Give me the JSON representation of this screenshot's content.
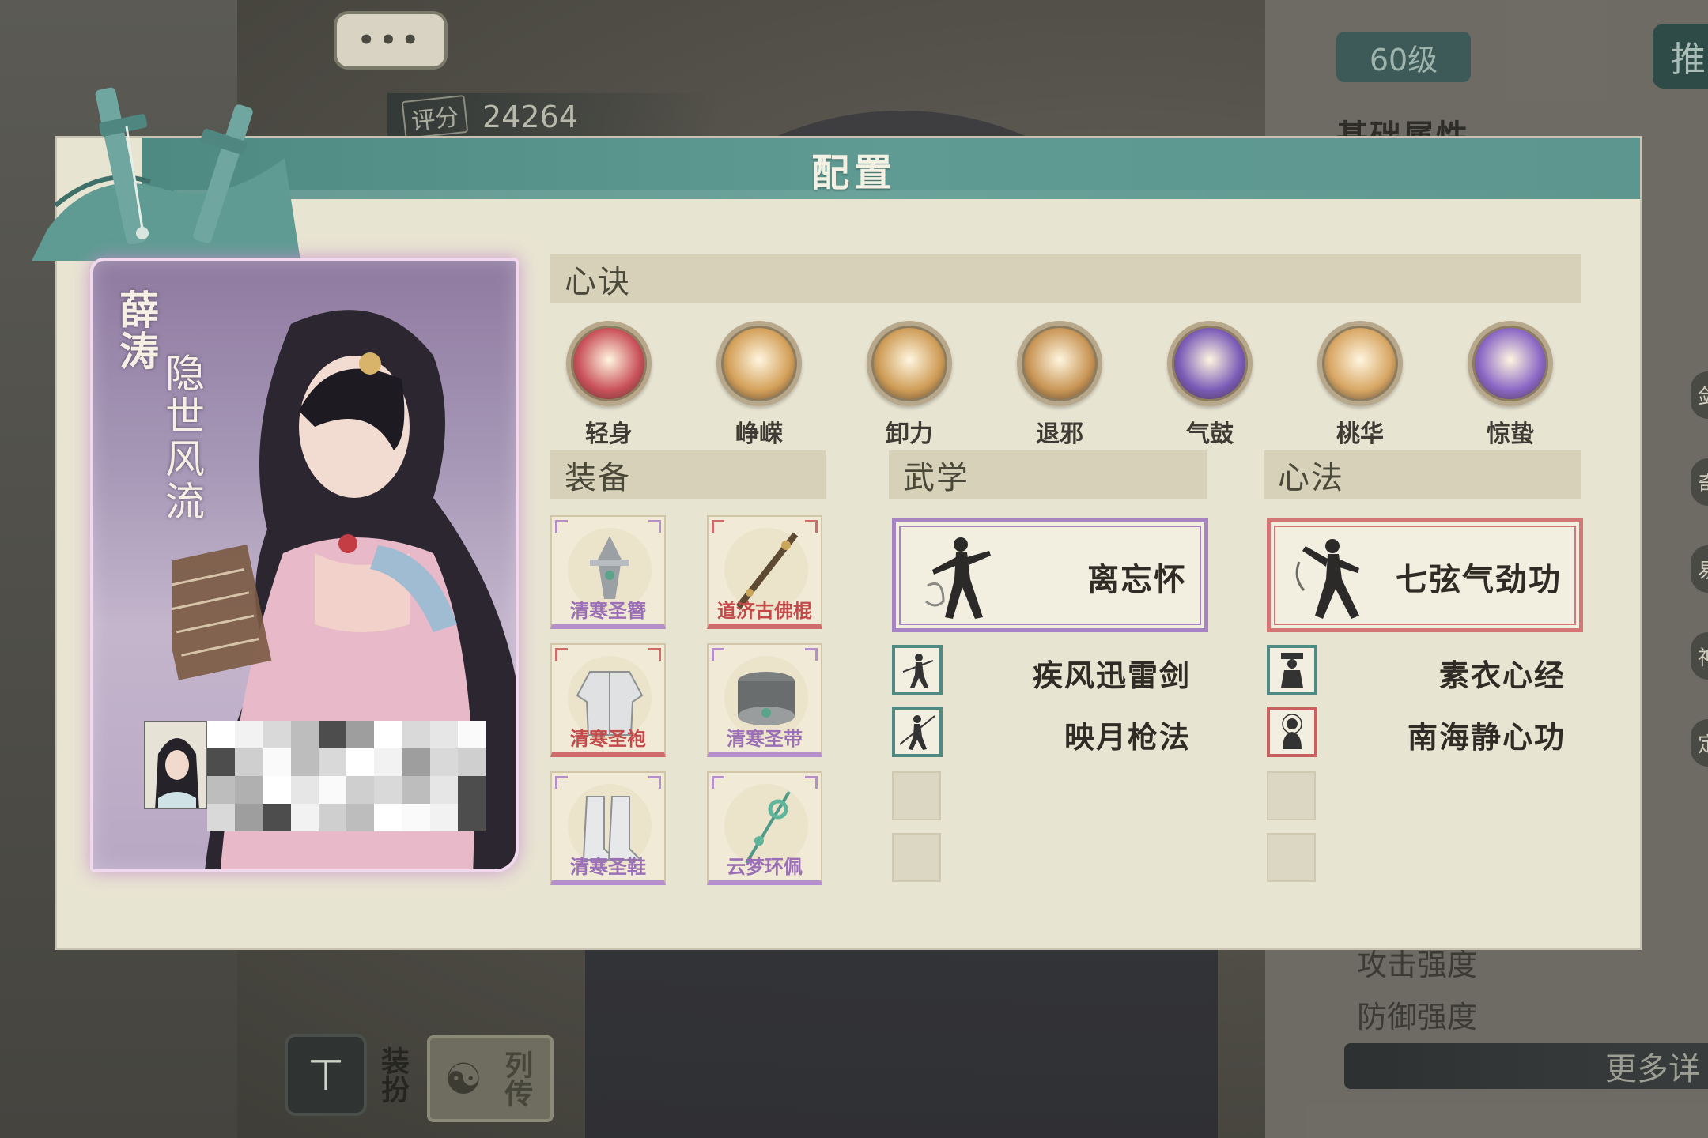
{
  "background": {
    "score_label": "评分",
    "score_value": "24264",
    "level": "60级",
    "top_right_button": "推",
    "basic_attr_title": "基础属性",
    "stats": [
      "攻击强度",
      "防御强度"
    ],
    "more_button": "更多详",
    "right_edge_icons": [
      "剑",
      "奇",
      "易",
      "神",
      "定"
    ],
    "dress_label": "装扮",
    "bio_label": "列传"
  },
  "modal": {
    "title": "配置",
    "character": {
      "name": "薛涛",
      "title": "隐世风流",
      "player_name_mosaic": true
    },
    "xinjue": {
      "header": "心诀",
      "items": [
        {
          "label": "轻身",
          "color": "#c9515a"
        },
        {
          "label": "峥嵘",
          "color": "#d4a15b"
        },
        {
          "label": "卸力",
          "color": "#cf9d58"
        },
        {
          "label": "退邪",
          "color": "#c99657"
        },
        {
          "label": "气鼓",
          "color": "#7a5bb7"
        },
        {
          "label": "桃华",
          "color": "#d8a765"
        },
        {
          "label": "惊蛰",
          "color": "#8a67c5"
        }
      ]
    },
    "equipment": {
      "header": "装备",
      "items": [
        {
          "name": "清寒圣簪",
          "rarity": "purple",
          "icon": "hairpin-icon"
        },
        {
          "name": "道济古佛棍",
          "rarity": "red",
          "icon": "staff-icon"
        },
        {
          "name": "清寒圣袍",
          "rarity": "red",
          "icon": "robe-icon"
        },
        {
          "name": "清寒圣带",
          "rarity": "purple",
          "icon": "belt-icon"
        },
        {
          "name": "清寒圣鞋",
          "rarity": "purple",
          "icon": "boots-icon"
        },
        {
          "name": "云梦环佩",
          "rarity": "purple",
          "icon": "jade-pendant-icon"
        }
      ]
    },
    "martial": {
      "header": "武学",
      "main": {
        "name": "离忘怀",
        "rarity": "purple"
      },
      "subs": [
        {
          "name": "疾风迅雷剑"
        },
        {
          "name": "映月枪法"
        }
      ],
      "empty_slots": 2
    },
    "xinfa": {
      "header": "心法",
      "main": {
        "name": "七弦气劲功",
        "rarity": "red"
      },
      "subs": [
        {
          "name": "素衣心经",
          "rarity": "teal"
        },
        {
          "name": "南海静心功",
          "rarity": "red"
        }
      ],
      "empty_slots": 2
    }
  }
}
